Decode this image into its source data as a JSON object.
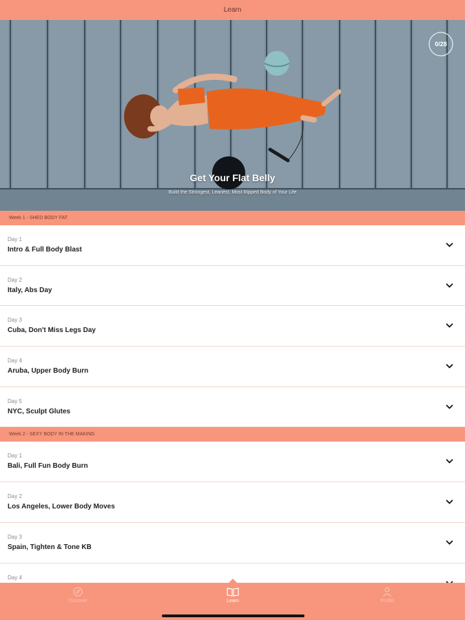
{
  "header": {
    "title": "Learn"
  },
  "hero": {
    "title": "Get Your Flat Belly",
    "subtitle": "Build the Strongest, Leanest, Most Ripped Body of Your Life",
    "progress": "0/28"
  },
  "weeks": [
    {
      "label": "Week 1 - SHED BODY FAT",
      "days": [
        {
          "day": "Day 1",
          "name": "Intro & Full Body Blast"
        },
        {
          "day": "Day 2",
          "name": "Italy, Abs Day"
        },
        {
          "day": "Day 3",
          "name": "Cuba, Don't Miss Legs Day"
        },
        {
          "day": "Day 4",
          "name": "Aruba, Upper Body Burn"
        },
        {
          "day": "Day 5",
          "name": "NYC, Sculpt Glutes"
        }
      ]
    },
    {
      "label": "Week 2 - SEXY BODY IN THE MAKING",
      "days": [
        {
          "day": "Day 1",
          "name": "Bali, Full Fun Body Burn"
        },
        {
          "day": "Day 2",
          "name": "Los Angeles, Lower Body Moves"
        },
        {
          "day": "Day 3",
          "name": "Spain, Tighten & Tone KB"
        },
        {
          "day": "Day 4",
          "name": ""
        }
      ]
    }
  ],
  "tabs": [
    {
      "label": "Discover",
      "icon": "compass-icon"
    },
    {
      "label": "Learn",
      "icon": "book-icon"
    },
    {
      "label": "Profile",
      "icon": "person-icon"
    }
  ],
  "colors": {
    "accent": "#f7967d",
    "divider": "#f3d6cf"
  }
}
